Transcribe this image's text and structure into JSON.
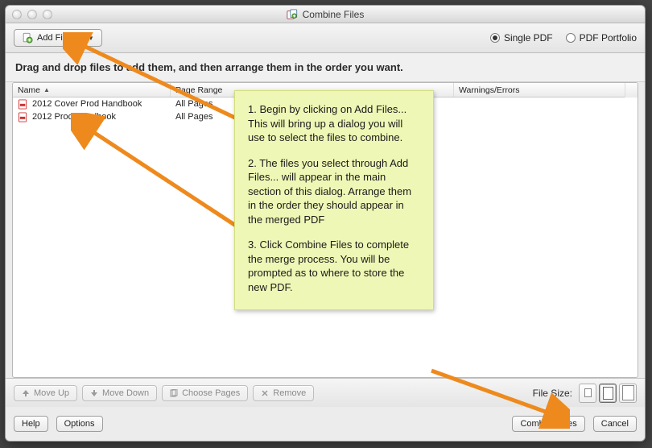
{
  "window": {
    "title": "Combine Files"
  },
  "toolbar": {
    "add_files_label": "Add Files...",
    "single_pdf_label": "Single PDF",
    "portfolio_label": "PDF Portfolio"
  },
  "instruction": "Drag and drop files to add them, and then arrange them in the order you want.",
  "columns": {
    "name": "Name",
    "page_range": "Page Range",
    "warnings": "Warnings/Errors"
  },
  "files": [
    {
      "name": "2012 Cover Prod Handbook",
      "range": "All Pages"
    },
    {
      "name": "2012 Prod Handbook",
      "range": "All Pages"
    }
  ],
  "lower": {
    "move_up": "Move Up",
    "move_down": "Move Down",
    "choose_pages": "Choose Pages",
    "remove": "Remove",
    "file_size": "File Size:"
  },
  "bottom": {
    "help": "Help",
    "options": "Options",
    "combine": "Combine Files",
    "cancel": "Cancel"
  },
  "callout": {
    "p1": "1. Begin by clicking on Add Files... This will bring up a dialog you will use to select the files to combine.",
    "p2": "2. The files you select through Add Files... will appear in the main section of this dialog. Arrange them in the order they should appear in the merged PDF",
    "p3": "3. Click Combine Files to complete the merge process. You will be prompted as to where to store the new PDF."
  }
}
